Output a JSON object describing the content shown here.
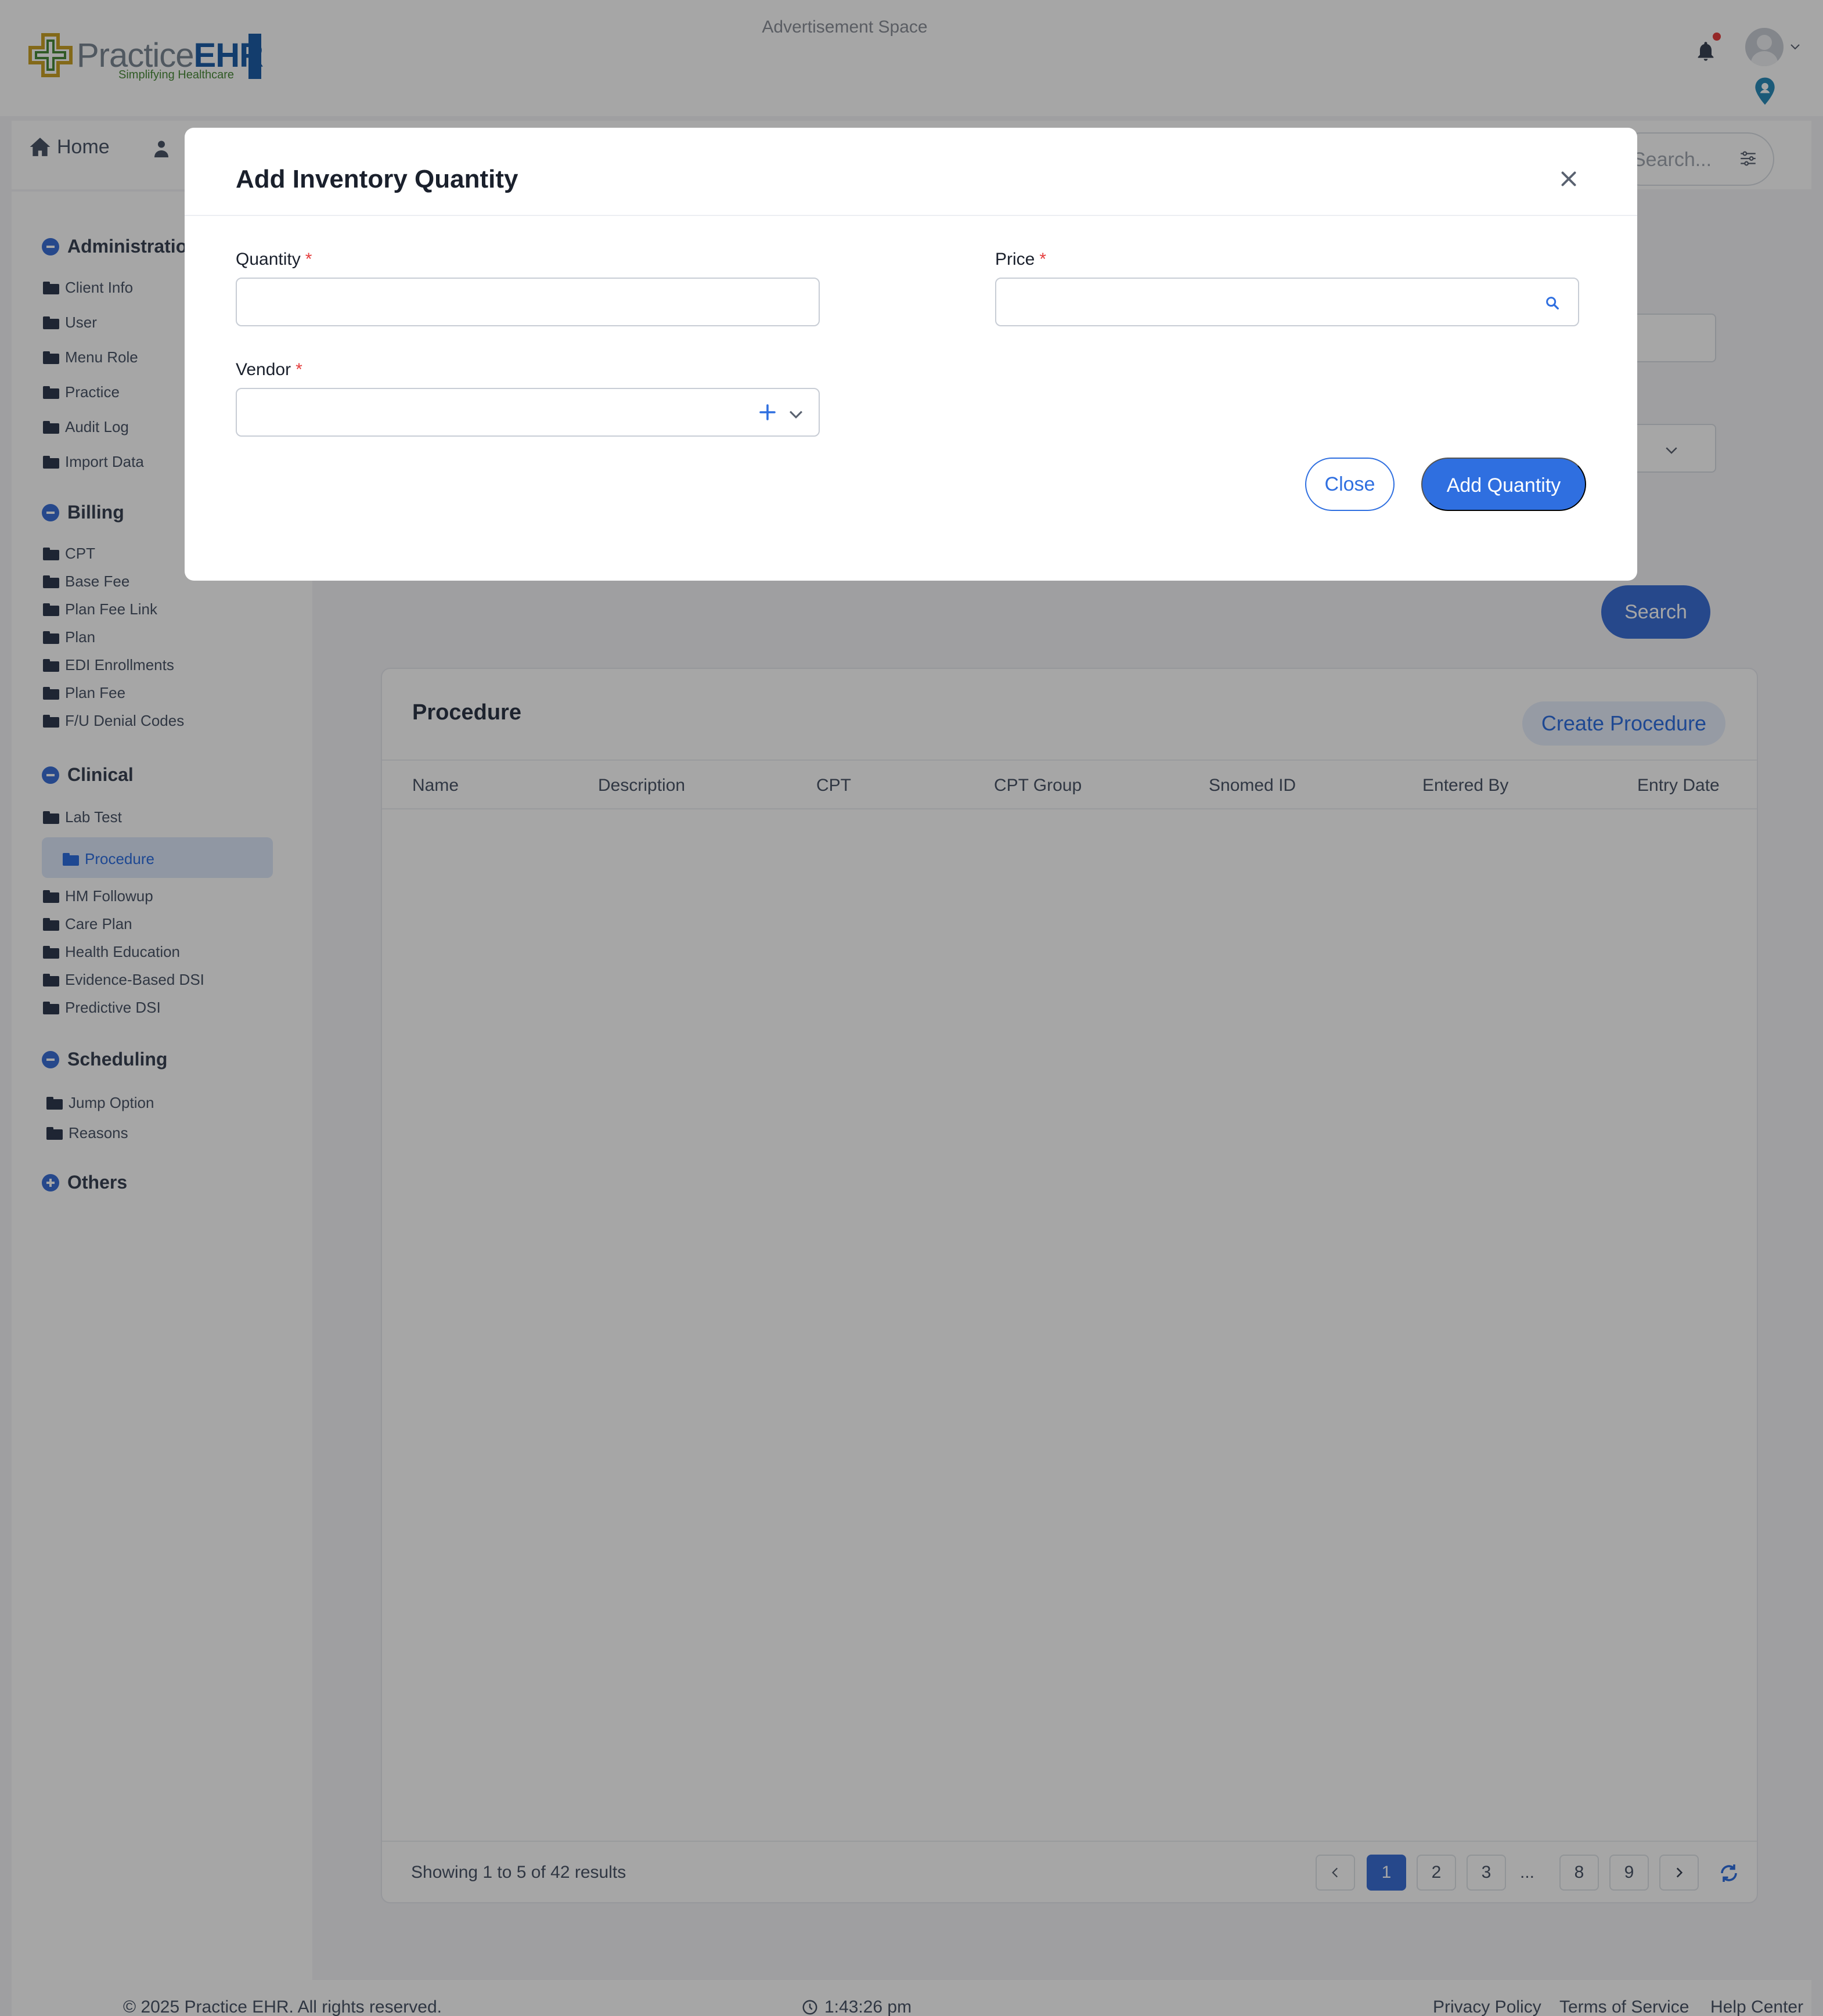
{
  "header": {
    "logo_text": "PracticeEHR",
    "logo_tagline": "Simplifying Healthcare",
    "ad_space": "Advertisement Space",
    "icons": [
      "bell-icon",
      "avatar",
      "chevron-down-icon",
      "location-pin-icon"
    ]
  },
  "topnav": {
    "home_label": "Home",
    "search_placeholder": "Search..."
  },
  "sidebar": {
    "sections": [
      {
        "title": "Administration",
        "items": [
          "Client Info",
          "User",
          "Menu Role",
          "Practice",
          "Audit Log",
          "Import Data"
        ]
      },
      {
        "title": "Billing",
        "items": [
          "CPT",
          "Base Fee",
          "Plan Fee Link",
          "Plan",
          "EDI Enrollments",
          "Plan Fee",
          "F/U Denial Codes"
        ]
      },
      {
        "title": "Clinical",
        "items": [
          "Lab Test",
          "Procedure",
          "HM Followup",
          "Care Plan",
          "Health Education",
          "Evidence-Based DSI",
          "Predictive DSI"
        ]
      },
      {
        "title": "Scheduling",
        "items": [
          "Jump Option",
          "Reasons"
        ]
      },
      {
        "title": "Others",
        "items": []
      }
    ],
    "active_item": "Procedure"
  },
  "main": {
    "search_button": "Search",
    "card": {
      "title": "Procedure",
      "create_button": "Create Procedure",
      "columns": [
        "Name",
        "Description",
        "CPT",
        "CPT Group",
        "Snomed ID",
        "Entered By",
        "Entry Date"
      ],
      "rows": []
    },
    "pagination": {
      "showing_text": "Showing 1 to 5 of 42 results",
      "pages": [
        "1",
        "2",
        "3",
        "...",
        "8",
        "9"
      ],
      "current": "1"
    }
  },
  "footer": {
    "copyright": "© 2025 Practice EHR. All rights reserved.",
    "time": "1:43:26 pm",
    "links": [
      "Privacy Policy",
      "Terms of Service",
      "Help Center"
    ]
  },
  "modal": {
    "title": "Add Inventory Quantity",
    "fields": {
      "quantity": {
        "label": "Quantity",
        "required_mark": "*",
        "value": ""
      },
      "price": {
        "label": "Price",
        "required_mark": "*",
        "value": ""
      },
      "vendor": {
        "label": "Vendor",
        "required_mark": "*",
        "value": ""
      }
    },
    "close_button": "Close",
    "add_button": "Add Quantity"
  },
  "colors": {
    "primary": "#2f6fe0",
    "required": "#e53e3e",
    "overlay": "rgba(0,0,0,0.35)"
  }
}
